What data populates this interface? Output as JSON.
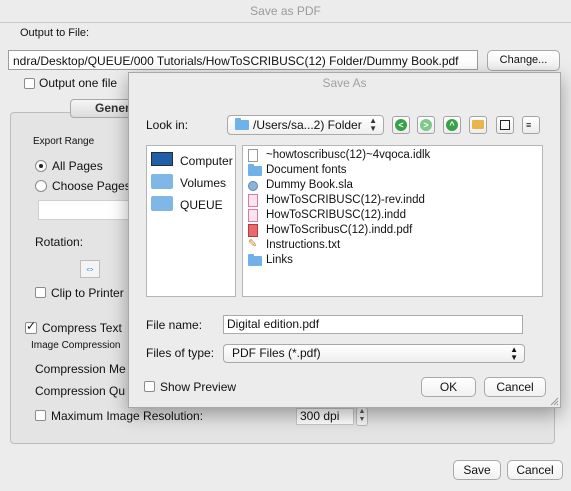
{
  "pdf_window": {
    "title": "Save as PDF",
    "output_label": "Output to File:",
    "output_path": "ndra/Desktop/QUEUE/000 Tutorials/HowToSCRIBUSC(12) Folder/Dummy Book.pdf",
    "change_button": "Change...",
    "one_file_label": "Output one file",
    "tab_general": "Gener",
    "export_range_label": "Export Range",
    "all_pages": "All Pages",
    "choose_pages": "Choose Pages",
    "rotation_label": "Rotation:",
    "clip_label": "Clip to Printer",
    "compress_text": "Compress Text",
    "image_compression_label": "Image Compression",
    "compression_method": "Compression Me",
    "compression_quality": "Compression Qu",
    "max_res_label": "Maximum Image Resolution:",
    "dpi_value": "300 dpi",
    "save_button": "Save",
    "cancel_button": "Cancel"
  },
  "save_as": {
    "title": "Save As",
    "look_in_label": "Look in:",
    "folder": "/Users/sa...2) Folder",
    "places": [
      "Computer",
      "Volumes",
      "QUEUE"
    ],
    "files": [
      {
        "name": "~howtoscribusc(12)~4vqoca.idlk",
        "icon": "doc"
      },
      {
        "name": "Document fonts",
        "icon": "folder"
      },
      {
        "name": "Dummy Book.sla",
        "icon": "sla"
      },
      {
        "name": "HowToSCRIBUSC(12)-rev.indd",
        "icon": "indd"
      },
      {
        "name": "HowToSCRIBUSC(12).indd",
        "icon": "indd"
      },
      {
        "name": "HowToScribusC(12).indd.pdf",
        "icon": "pdf"
      },
      {
        "name": "Instructions.txt",
        "icon": "txt"
      },
      {
        "name": "Links",
        "icon": "folder"
      }
    ],
    "file_name_label": "File name:",
    "file_name_value": "Digital edition.pdf",
    "file_type_label": "Files of type:",
    "file_type_value": "PDF Files (*.pdf)",
    "show_preview": "Show Preview",
    "ok_button": "OK",
    "cancel_button": "Cancel"
  }
}
